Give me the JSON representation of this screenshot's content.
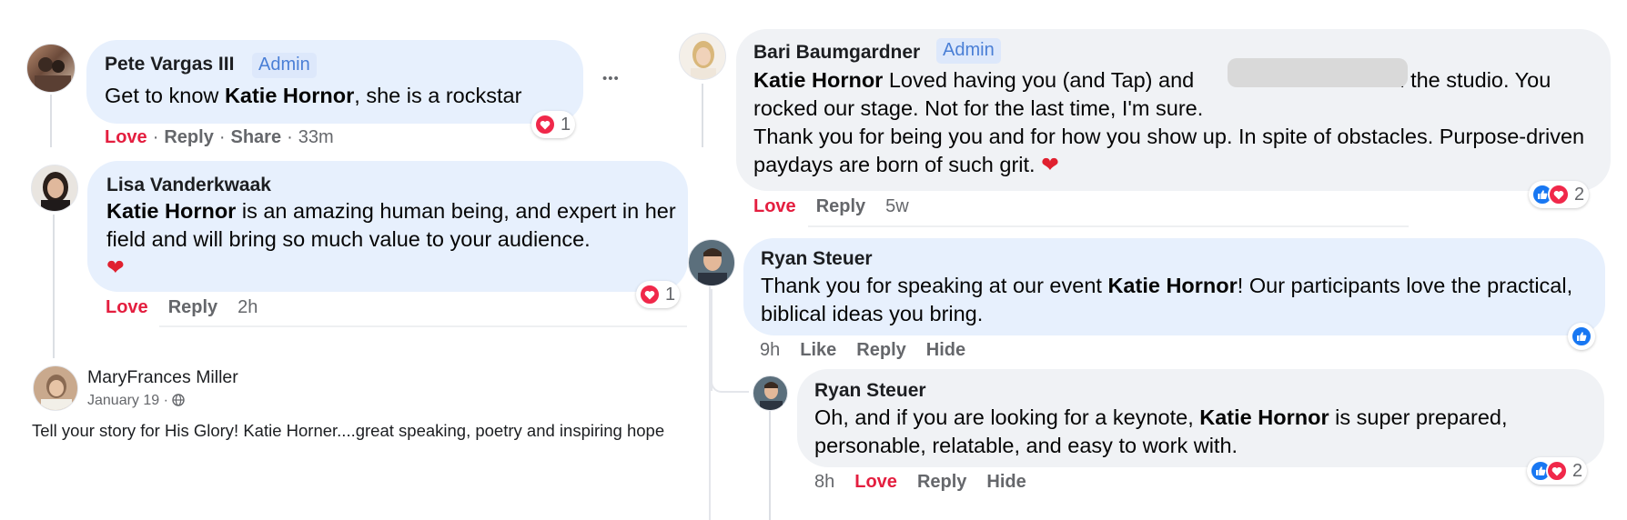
{
  "colors": {
    "love": "#e41e3f",
    "like": "#1877f2",
    "admin_bg": "#dde8fb",
    "admin_text": "#4a7fd6",
    "bubble_blue": "#e7f0fd",
    "bubble_grey": "#f0f2f5"
  },
  "c1": {
    "name": "Pete Vargas III",
    "badge": "Admin",
    "text_pre": "Get to know ",
    "text_bold": "Katie Hornor",
    "text_post": ", she is a rockstar",
    "more": "•••",
    "actions": {
      "love": "Love",
      "reply": "Reply",
      "share": "Share",
      "time": "33m",
      "sep": "·"
    },
    "reaction": {
      "icons": [
        "heart-icon"
      ],
      "count": "1"
    }
  },
  "c2": {
    "name": "Lisa Vanderkwaak",
    "text_bold": "Katie Hornor",
    "text_post": " is an amazing human being, and expert in her field and will bring so much value to your audience.",
    "emoji": "❤️",
    "actions": {
      "love": "Love",
      "reply": "Reply",
      "time": "2h"
    },
    "reaction": {
      "icons": [
        "heart-icon"
      ],
      "count": "1"
    }
  },
  "post": {
    "author": "MaryFrances Miller",
    "date": "January 19",
    "sep": "·",
    "text": "Tell your story for His Glory! Katie Horner....great speaking, poetry and inspiring hope"
  },
  "c3": {
    "name": "Bari Baumgardner",
    "badge": "Admin",
    "text_bold": "Katie Hornor",
    "text_1": " Loved having you (and Tap) and ",
    "text_2": " in the studio. You rocked our stage. Not for the last time, I'm sure.",
    "text_3": "Thank you for being you and for how you show up. In spite of obstacles. Purpose-driven paydays are born of such grit. ",
    "emoji": "❤️",
    "actions": {
      "love": "Love",
      "reply": "Reply",
      "time": "5w"
    },
    "reaction": {
      "icons": [
        "like-icon",
        "heart-icon"
      ],
      "count": "2"
    }
  },
  "c4": {
    "name": "Ryan Steuer",
    "text_pre": "Thank you for speaking at our event ",
    "text_bold": "Katie Hornor",
    "text_post": "! Our participants love the practical, biblical ideas you bring.",
    "actions": {
      "time": "9h",
      "like": "Like",
      "reply": "Reply",
      "hide": "Hide"
    },
    "reaction": {
      "icons": [
        "like-icon"
      ]
    }
  },
  "c5": {
    "name": "Ryan Steuer",
    "text_pre": "Oh, and if you are looking for a keynote, ",
    "text_bold": "Katie Hornor",
    "text_post": " is super prepared, personable, relatable, and easy to work with.",
    "actions": {
      "time": "8h",
      "love": "Love",
      "reply": "Reply",
      "hide": "Hide"
    },
    "reaction": {
      "icons": [
        "like-icon",
        "heart-icon"
      ],
      "count": "2"
    }
  }
}
